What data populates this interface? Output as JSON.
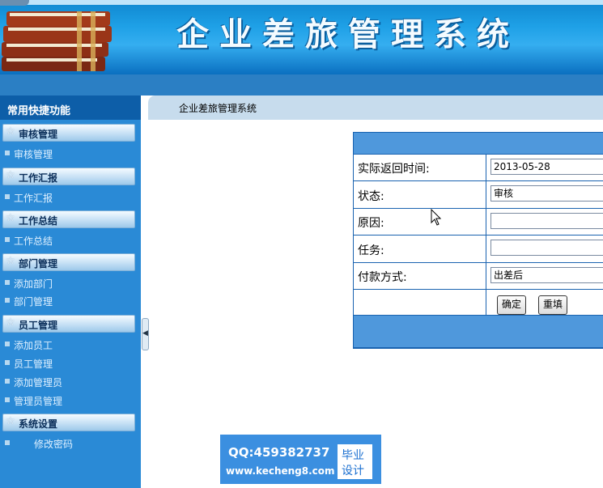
{
  "header": {
    "system_title": "企业差旅管理系统"
  },
  "sidebar": {
    "title": "常用快捷功能",
    "groups": [
      {
        "label": "审核管理",
        "items": [
          "审核管理"
        ]
      },
      {
        "label": "工作汇报",
        "items": [
          "工作汇报"
        ]
      },
      {
        "label": "工作总结",
        "items": [
          "工作总结"
        ]
      },
      {
        "label": "部门管理",
        "items": [
          "添加部门",
          "部门管理"
        ]
      },
      {
        "label": "员工管理",
        "items": [
          "添加员工",
          "员工管理",
          "添加管理员",
          "管理员管理"
        ]
      },
      {
        "label": "系统设置",
        "items": [
          "修改密码"
        ]
      }
    ]
  },
  "breadcrumb": "企业差旅管理系统",
  "form": {
    "fields": [
      {
        "label": "实际返回时间:",
        "value": "2013-05-28"
      },
      {
        "label": "状态:",
        "value": "审核"
      },
      {
        "label": "原因:",
        "value": ""
      },
      {
        "label": "任务:",
        "value": ""
      },
      {
        "label": "付款方式:",
        "value": "出差后"
      }
    ],
    "buttons": {
      "confirm": "确定",
      "reset": "重填"
    }
  },
  "watermark": {
    "qq": "QQ:459382737",
    "url": "www.kecheng8.com",
    "badge_line1": "毕业",
    "badge_line2": "设计"
  }
}
